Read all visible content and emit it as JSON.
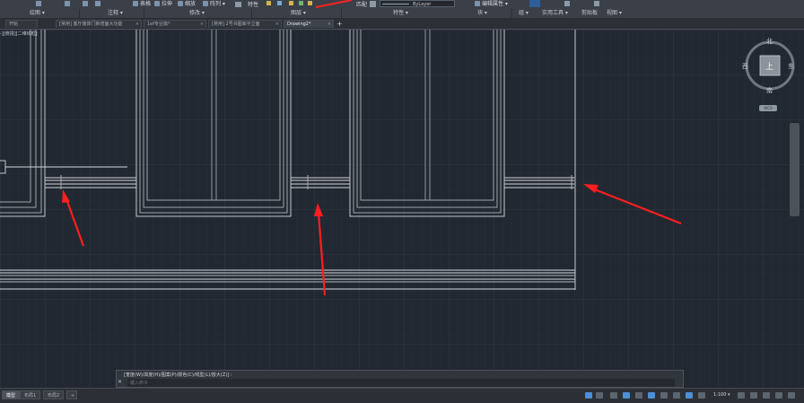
{
  "ribbon": {
    "buttons": [
      {
        "label": "表格"
      },
      {
        "label": "拉伸"
      },
      {
        "label": "缩放"
      },
      {
        "label": "阵列 ▾"
      },
      {
        "label": "特性"
      },
      {
        "label": "匹配"
      },
      {
        "label": "编辑属性 ▾"
      }
    ],
    "layer_combo": "ByLayer",
    "panels": [
      "绘图 ▾",
      "注释 ▾",
      "修改 ▾",
      "图层 ▾",
      "块 ▾",
      "特性 ▾",
      "组 ▾",
      "实用工具 ▾",
      "剪贴板",
      "视图 ▾"
    ]
  },
  "tabs": [
    {
      "label": "开始"
    },
    {
      "label": "[常用] 客厅装饰门新增面大功能"
    },
    {
      "label": "1ef专业篇*"
    },
    {
      "label": "[常用] 2号书图库平立面"
    },
    {
      "label": "Drawing2*"
    }
  ],
  "viewport": {
    "label": "-][俯视][二维线框]"
  },
  "viewcube": {
    "north": "北",
    "south": "南",
    "east": "东",
    "west": "西",
    "top": "上",
    "wcs": "WCS"
  },
  "command": {
    "history": "[宽度(W)/高度(H)/图案(P)/颜色(C)/线型(L)/放大(Z)] :",
    "placeholder": "键入命令"
  },
  "status": {
    "tabs": [
      "模型",
      "布局1",
      "布局2"
    ],
    "scale": "1:100 ▾"
  },
  "colors": {
    "background": "#222831",
    "lines": "#d4d9df",
    "arrows": "#ff1e1e"
  }
}
